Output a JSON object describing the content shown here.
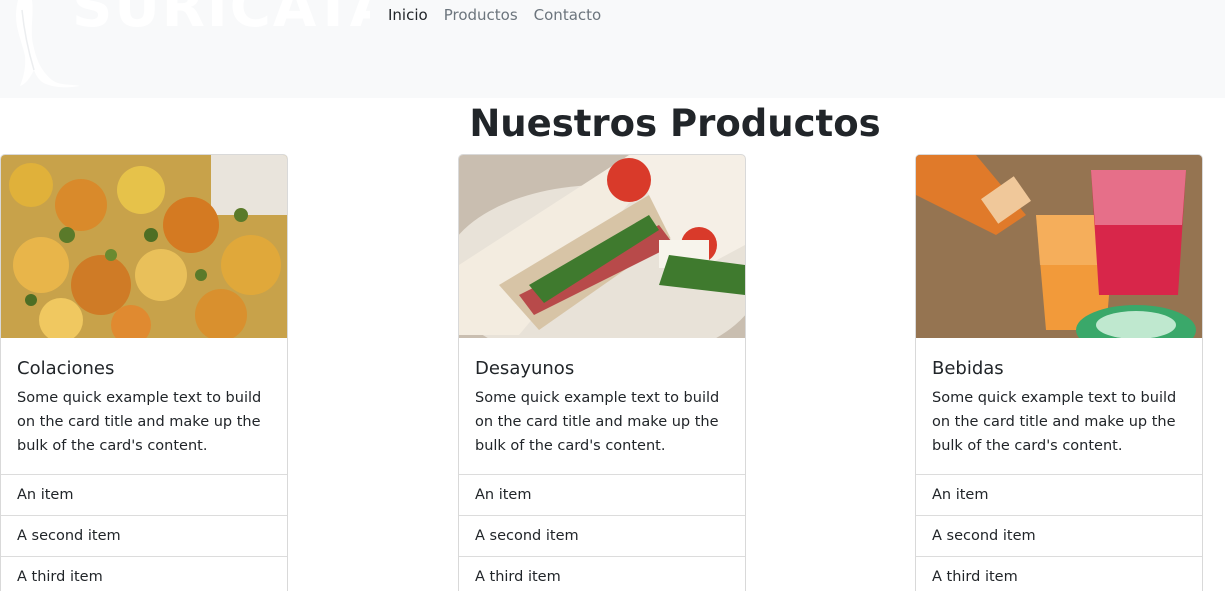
{
  "brand": {
    "name": "SURICATA"
  },
  "nav": {
    "links": [
      {
        "label": "Inicio",
        "active": true
      },
      {
        "label": "Productos",
        "active": false
      },
      {
        "label": "Contacto",
        "active": false
      }
    ]
  },
  "main": {
    "heading": "Nuestros Productos",
    "cards": [
      {
        "title": "Colaciones",
        "text": "Some quick example text to build on the card title and make up the bulk of the card's content.",
        "image": "food-stew-photo",
        "items": [
          "An item",
          "A second item",
          "A third item"
        ]
      },
      {
        "title": "Desayunos",
        "text": "Some quick example text to build on the card title and make up the bulk of the card's content.",
        "image": "sandwich-photo",
        "items": [
          "An item",
          "A second item",
          "A third item"
        ]
      },
      {
        "title": "Bebidas",
        "text": "Some quick example text to build on the card title and make up the bulk of the card's content.",
        "image": "drinks-photo",
        "items": [
          "An item",
          "A second item",
          "A third item"
        ]
      }
    ]
  },
  "colors": {
    "navbar_bg": "#f8f9fa",
    "nav_link": "#6c757d",
    "nav_link_active": "#212529",
    "text": "#212529",
    "border": "#dcdcdc"
  }
}
